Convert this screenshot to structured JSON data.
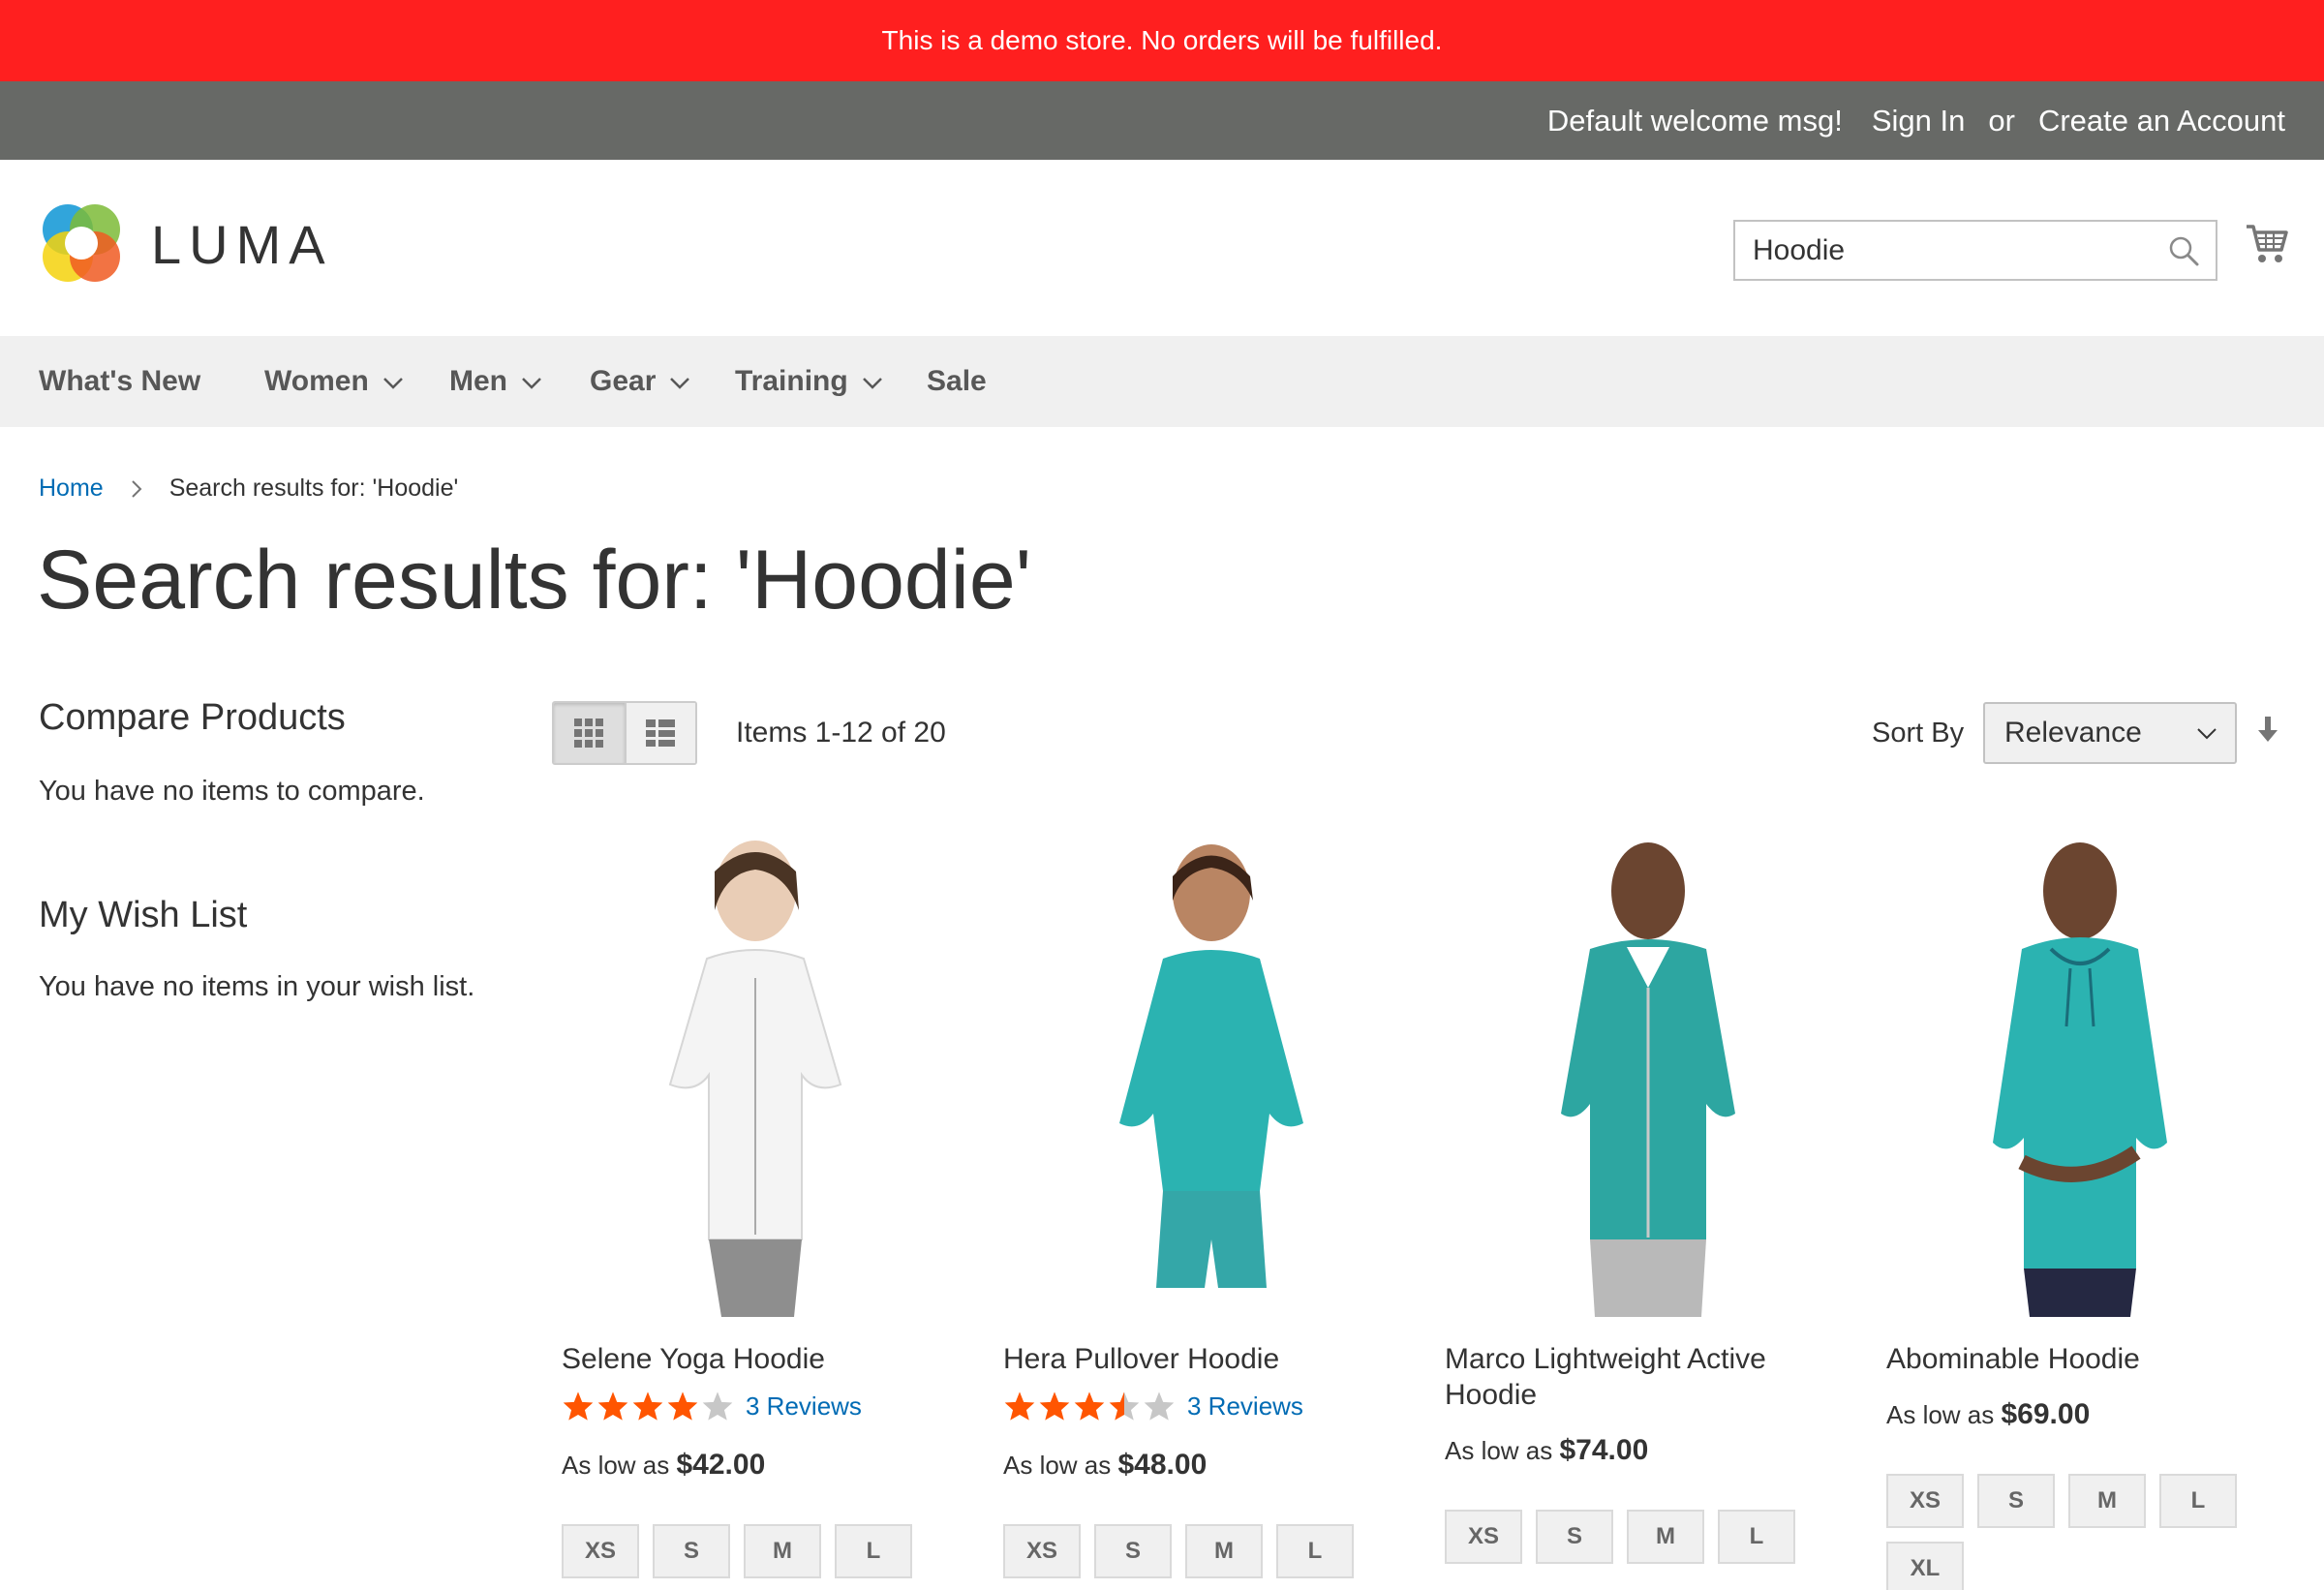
{
  "demo_notice": "This is a demo store. No orders will be fulfilled.",
  "top_links": {
    "welcome": "Default welcome msg!",
    "sign_in": "Sign In",
    "or": "or",
    "create_account": "Create an Account"
  },
  "logo": {
    "text": "LUMA"
  },
  "search": {
    "value": "Hoodie",
    "icon": "search-icon"
  },
  "nav": {
    "items": [
      {
        "label": "What's New",
        "has_dropdown": false
      },
      {
        "label": "Women",
        "has_dropdown": true
      },
      {
        "label": "Men",
        "has_dropdown": true
      },
      {
        "label": "Gear",
        "has_dropdown": true
      },
      {
        "label": "Training",
        "has_dropdown": true
      },
      {
        "label": "Sale",
        "has_dropdown": false
      }
    ]
  },
  "breadcrumbs": {
    "home": "Home",
    "current": "Search results for: 'Hoodie'"
  },
  "page_title": "Search results for: 'Hoodie'",
  "sidebar": {
    "compare_title": "Compare Products",
    "compare_empty": "You have no items to compare.",
    "wishlist_title": "My Wish List",
    "wishlist_empty": "You have no items in your wish list."
  },
  "toolbar": {
    "amount": "Items 1-12 of 20",
    "sort_label": "Sort By",
    "sort_value": "Relevance",
    "view_modes": [
      "grid",
      "list"
    ],
    "active_mode": "grid"
  },
  "colors": {
    "demo_red": "#ff1f1f",
    "top_bar": "#676966",
    "link_blue": "#006bb4",
    "star_orange": "#ff5501",
    "product_teal": "#2bb3b1"
  },
  "products": [
    {
      "name": "Selene Yoga Hoodie",
      "rating": 4,
      "reviews": "3 Reviews",
      "price_prefix": "As low as",
      "price": "$42.00",
      "sizes": [
        "XS",
        "S",
        "M",
        "L"
      ]
    },
    {
      "name": "Hera Pullover Hoodie",
      "rating": 3.5,
      "reviews": "3 Reviews",
      "price_prefix": "As low as",
      "price": "$48.00",
      "sizes": [
        "XS",
        "S",
        "M",
        "L"
      ]
    },
    {
      "name": "Marco Lightweight Active Hoodie",
      "rating": null,
      "reviews": "",
      "price_prefix": "As low as",
      "price": "$74.00",
      "sizes": [
        "XS",
        "S",
        "M",
        "L"
      ]
    },
    {
      "name": "Abominable Hoodie",
      "rating": null,
      "reviews": "",
      "price_prefix": "As low as",
      "price": "$69.00",
      "sizes": [
        "XS",
        "S",
        "M",
        "L",
        "XL"
      ]
    }
  ]
}
